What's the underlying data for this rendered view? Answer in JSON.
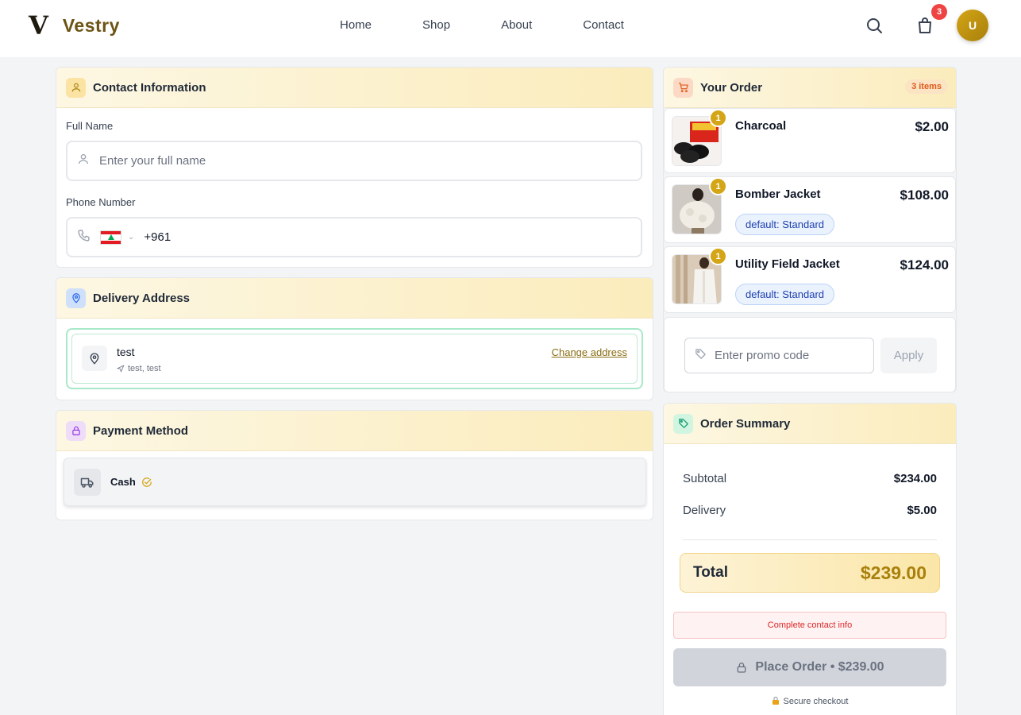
{
  "header": {
    "logo_mark": "V",
    "brand": "Vestry",
    "nav": [
      "Home",
      "Shop",
      "About",
      "Contact"
    ],
    "cart_count": "3",
    "avatar_initial": "U"
  },
  "contact": {
    "title": "Contact Information",
    "full_name_label": "Full Name",
    "full_name_placeholder": "Enter your full name",
    "phone_label": "Phone Number",
    "dial_code": "+961"
  },
  "delivery": {
    "title": "Delivery Address",
    "address_name": "test",
    "address_line": "test, test",
    "change_label": "Change address"
  },
  "payment": {
    "title": "Payment Method",
    "method": "Cash"
  },
  "order": {
    "title": "Your Order",
    "items_badge": "3 items",
    "items": [
      {
        "qty": "1",
        "name": "Charcoal",
        "price": "$2.00",
        "variant": ""
      },
      {
        "qty": "1",
        "name": "Bomber Jacket",
        "price": "$108.00",
        "variant": "default: Standard"
      },
      {
        "qty": "1",
        "name": "Utility Field Jacket",
        "price": "$124.00",
        "variant": "default: Standard"
      }
    ],
    "promo_placeholder": "Enter promo code",
    "apply_label": "Apply"
  },
  "summary": {
    "title": "Order Summary",
    "subtotal_label": "Subtotal",
    "subtotal": "$234.00",
    "delivery_label": "Delivery",
    "delivery": "$5.00",
    "total_label": "Total",
    "total": "$239.00",
    "warning": "Complete contact info",
    "place_order": "Place Order • $239.00",
    "secure": "Secure checkout"
  },
  "colors": {
    "accent": "#d4a516",
    "brand_text": "#6b5414",
    "badge_red": "#ef4444"
  }
}
